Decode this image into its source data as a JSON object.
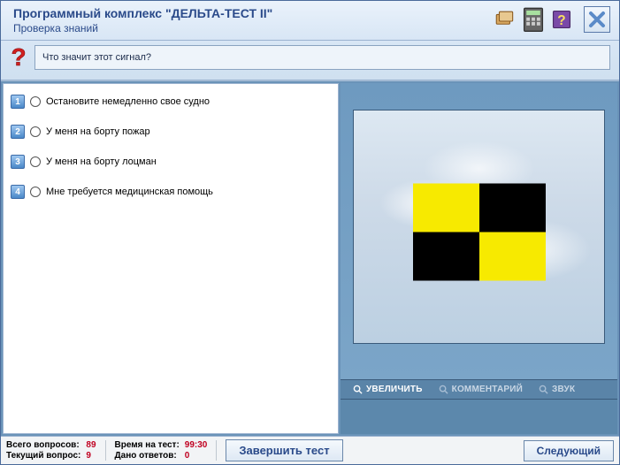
{
  "header": {
    "title": "Программный комплекс \"ДЕЛЬТА-ТЕСТ II\"",
    "subtitle": "Проверка знаний"
  },
  "question": {
    "text": "Что значит этот сигнал?"
  },
  "answers": [
    {
      "num": "1",
      "label": "Остановите немедленно свое судно"
    },
    {
      "num": "2",
      "label": "У меня на борту пожар"
    },
    {
      "num": "3",
      "label": "У меня на борту лоцман"
    },
    {
      "num": "4",
      "label": "Мне требуется медицинская помощь"
    }
  ],
  "media": {
    "tools": {
      "zoom": "УВЕЛИЧИТЬ",
      "comment": "КОММЕНТАРИЙ",
      "sound": "ЗВУК"
    },
    "flag": {
      "pattern": [
        "yellow",
        "black",
        "black",
        "yellow"
      ],
      "meaning_hint": "signal-flag-L"
    }
  },
  "footer": {
    "total_questions_label": "Всего вопросов:",
    "total_questions_value": "89",
    "current_question_label": "Текущий вопрос:",
    "current_question_value": "9",
    "time_label": "Время на тест:",
    "time_value": "99:30",
    "answered_label": "Дано ответов:",
    "answered_value": "0",
    "finish_button": "Завершить тест",
    "next_button": "Следующий"
  }
}
